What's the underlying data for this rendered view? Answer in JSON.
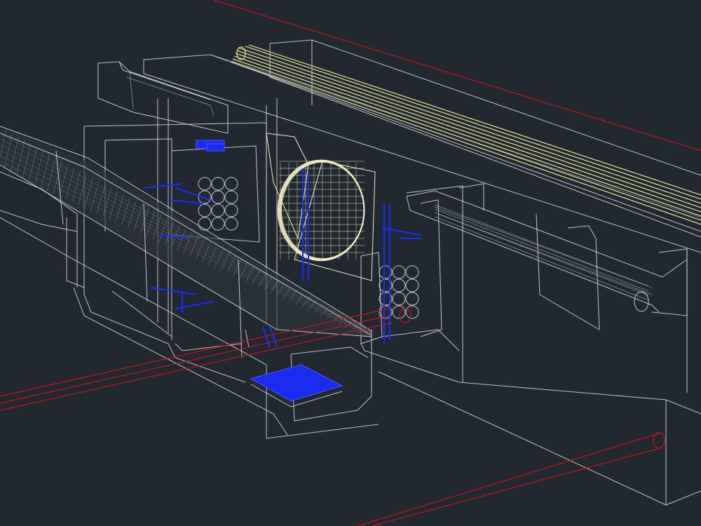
{
  "view": {
    "background": "#212830",
    "style": "3D wireframe",
    "colors": {
      "structure": "#dfe3e8",
      "pipes_red": "#c8141e",
      "cable_bundle_yellow": "#d8d890",
      "fan": "#f3efc6",
      "fittings_blue": "#1b2cf0"
    }
  },
  "objects": [
    {
      "name": "utility-tunnel-structure",
      "icon": "wireframe-box"
    },
    {
      "name": "cable-tray-left",
      "icon": "mesh-tray"
    },
    {
      "name": "yellow-cable-bundle",
      "icon": "cable"
    },
    {
      "name": "ventilation-fan",
      "icon": "fan"
    },
    {
      "name": "conduit-duct-bank-left",
      "icon": "circle-array"
    },
    {
      "name": "conduit-duct-bank-right",
      "icon": "circle-array"
    },
    {
      "name": "red-pipeline-front",
      "icon": "pipe"
    },
    {
      "name": "red-pipeline-lower",
      "icon": "pipe"
    },
    {
      "name": "blue-sump-plate",
      "icon": "plate"
    },
    {
      "name": "right-trench-channel",
      "icon": "channel"
    }
  ]
}
